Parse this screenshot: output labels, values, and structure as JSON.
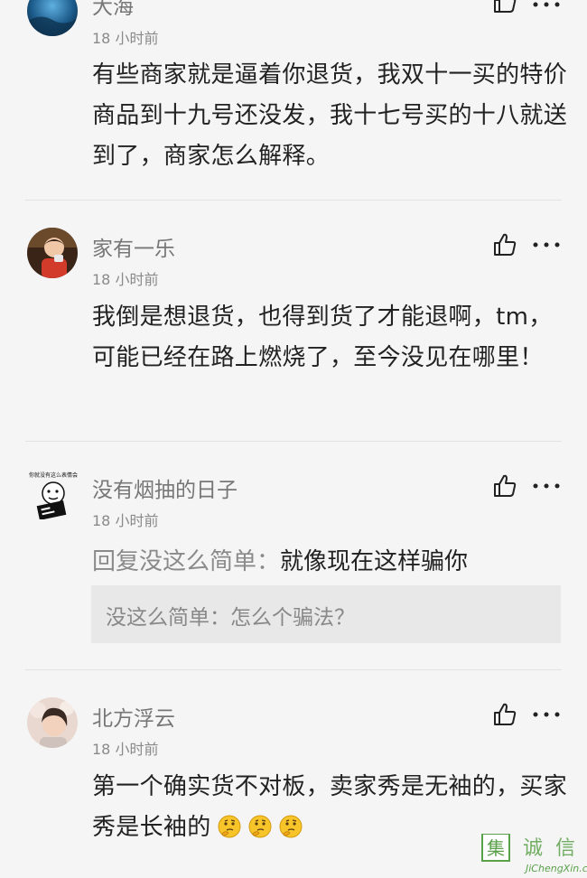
{
  "comments": [
    {
      "username": "大海",
      "time": "18 小时前",
      "text": "有些商家就是逼着你退货，我双十一买的特价商品到十九号还没发，我十七号买的十八就送到了，商家怎么解释。"
    },
    {
      "username": "家有一乐",
      "time": "18 小时前",
      "text": "我倒是想退货，也得到货了才能退啊，tm，可能已经在路上燃烧了，至今没见在哪里！"
    },
    {
      "username": "没有烟抽的日子",
      "time": "18 小时前",
      "reply_prefix": "回复没这么简单：",
      "reply_text": "就像现在这样骗你",
      "quote": "没这么简单：怎么个骗法？",
      "avatar_caption": "你就没有这么表情会不到今天"
    },
    {
      "username": "北方浮云",
      "time": "18 小时前",
      "text": "第一个确实货不对板，卖家秀是无袖的，买家秀是长袖的",
      "emojis": [
        "thinking-face",
        "thinking-face",
        "thinking-face"
      ]
    }
  ],
  "icons": {
    "like": "thumbs-up-icon",
    "more": "more-dots-icon"
  },
  "watermark": {
    "chars": "集诚信",
    "url": "JiChengXin.com"
  },
  "colors": {
    "background": "#f5f5f5",
    "username": "#777777",
    "body": "#222222",
    "quote_bg": "#e8e8e8",
    "watermark": "#5aa24a"
  }
}
